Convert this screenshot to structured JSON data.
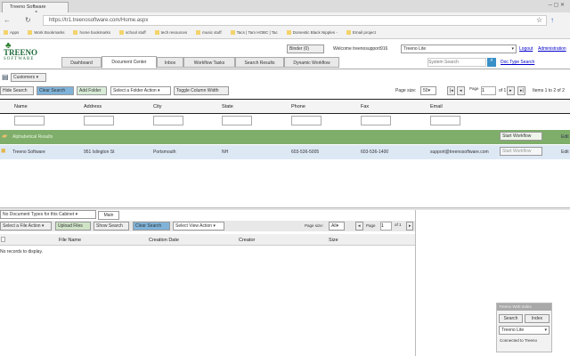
{
  "browser": {
    "tab_title": "Treeno Software",
    "url": "https://tr1.treenosoftware.com/Home.aspx",
    "bookmarks": [
      "Apps",
      "Work Bookmarks",
      "home bookmarks",
      "school stuff",
      "tech resources",
      "music stuff",
      "Tacs | Tam HOBC | Tac",
      "Domestic Black Nipples -",
      "Email project"
    ]
  },
  "header": {
    "logo_top": "TREENO",
    "logo_bottom": "SOFTWARE",
    "binder": "Binder (0)",
    "welcome": "Welcome treenosupport916",
    "cabinet_select": "Treeno Lite",
    "logout": "Logout",
    "admin": "Administration",
    "search_placeholder": "System Search",
    "doc_type_search": "Doc Type Search"
  },
  "nav": {
    "tabs": [
      "Dashboard",
      "Document Center",
      "Inbox",
      "Workflow Tasks",
      "Search Results",
      "Dynamic Workflow"
    ],
    "active": 1
  },
  "cabinet": {
    "selected": "Customers"
  },
  "toolbar": {
    "hide_search": "Hide Search",
    "clear_search": "Clear Search",
    "add_folder": "Add Folder",
    "folder_action": "Select a Folder Action",
    "toggle_width": "Toggle Column Width",
    "page_size_label": "Page size:",
    "page_size": "50",
    "page_label": "Page",
    "page": "1",
    "of": "of 1",
    "items": "Items 1 to 2 of 2"
  },
  "grid": {
    "columns": [
      "Name",
      "Address",
      "City",
      "State",
      "Phone",
      "Fax",
      "Email"
    ],
    "group_row": {
      "label": "Alphabetical Results",
      "button": "Start Workflow",
      "edit": "Edit"
    },
    "rows": [
      {
        "name": "Treeno Software",
        "address": "951 Islington St",
        "city": "Portsmouth",
        "state": "NH",
        "phone": "603-536-5005",
        "fax": "603-536-1400",
        "email": "support@treenosoftware.com",
        "button": "Start Workflow",
        "edit": "Edit"
      }
    ]
  },
  "lower": {
    "doc_types": "No Document Types for this Cabinet",
    "main_tab": "Main",
    "file_action": "Select a File Action",
    "upload": "Upload Files",
    "show_search": "Show Search",
    "clear_search": "Clear Search",
    "view_action": "Select View Action",
    "page_size_label": "Page size:",
    "page_size": "All",
    "page_label": "Page",
    "page": "1",
    "of": "of 1",
    "columns": [
      "File Name",
      "Creation Date",
      "Creator",
      "Size"
    ],
    "empty": "No records to display."
  },
  "widget": {
    "title": "Treeno Web Index",
    "search": "Search",
    "index": "Index",
    "select": "Treeno Lite",
    "status": "Connected to Treeno"
  }
}
